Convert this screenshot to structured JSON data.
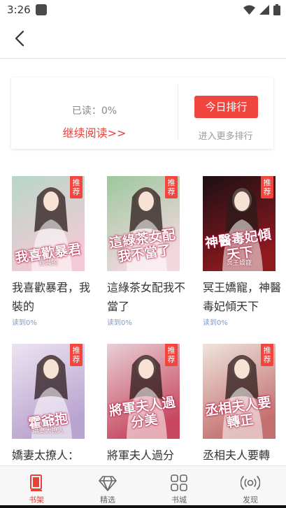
{
  "status_bar": {
    "time": "3:26"
  },
  "reading": {
    "progress": "已读：0%",
    "continue": "继续阅读>>",
    "rank_button": "今日排行",
    "more_rank": "进入更多排行"
  },
  "badge_label": "推荐",
  "books": [
    {
      "title": "我喜歡暴君，我裝的",
      "progress": "读到0%",
      "cover_text": "我喜歡暴君",
      "cover_sub": "我装的",
      "colors": [
        "#b7d7c8",
        "#f3c9d6"
      ]
    },
    {
      "title": "這綠茶女配我不當了",
      "progress": "读到0%",
      "cover_text": "這綠茶女配我不當了",
      "cover_sub": "",
      "colors": [
        "#9cc89c",
        "#f2d7df"
      ]
    },
    {
      "title": "冥王嬌寵，神醫毒妃傾天下",
      "progress": "读到0%",
      "cover_text": "神醫毒妃傾天下",
      "cover_sub": "冥王嬌寵",
      "colors": [
        "#1b0f14",
        "#8e1a1e"
      ]
    },
    {
      "title": "嬌妻太撩人：",
      "progress": "",
      "cover_text": "霍爺抱",
      "cover_sub": "嬌妻太撩人",
      "colors": [
        "#ece4f2",
        "#b9a3cf"
      ]
    },
    {
      "title": "將軍夫人過分",
      "progress": "",
      "cover_text": "將軍夫人過分美",
      "cover_sub": "",
      "colors": [
        "#e8cfd6",
        "#c7485f"
      ]
    },
    {
      "title": "丞相夫人要轉",
      "progress": "",
      "cover_text": "丞相夫人要轉正",
      "cover_sub": "",
      "colors": [
        "#efe4dc",
        "#c26f6f"
      ]
    }
  ],
  "tabs": [
    {
      "label": "书架",
      "icon": "bookshelf-icon",
      "active": true
    },
    {
      "label": "精选",
      "icon": "diamond-icon",
      "active": false
    },
    {
      "label": "书城",
      "icon": "grid-icon",
      "active": false
    },
    {
      "label": "发现",
      "icon": "broadcast-icon",
      "active": false
    }
  ],
  "colors": {
    "accent": "#e8413a",
    "rank_button": "#f0453e",
    "progress_text": "#7a9cc0"
  }
}
